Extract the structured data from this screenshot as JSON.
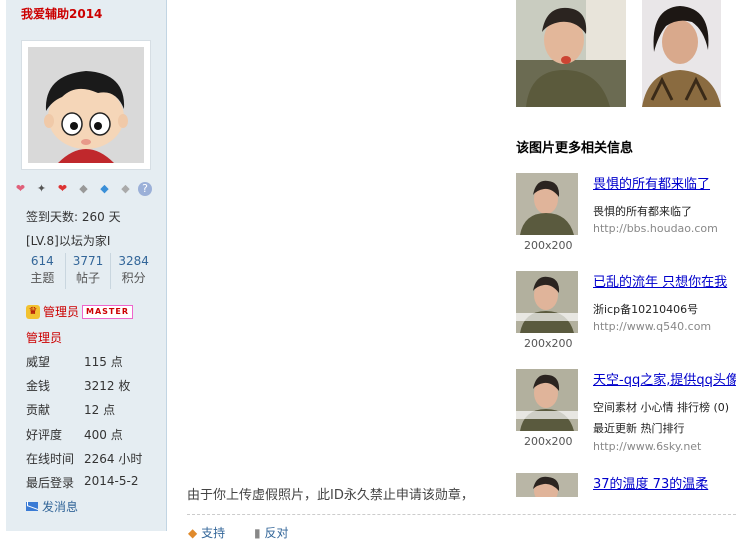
{
  "user": {
    "username": "我爱辅助2014",
    "checkin": "签到天数: 260 天",
    "level": "[LV.8]以坛为家I",
    "stats": [
      {
        "num": "614",
        "label": "主题"
      },
      {
        "num": "3771",
        "label": "帖子"
      },
      {
        "num": "3284",
        "label": "积分"
      }
    ],
    "group_badge_label": "管理员",
    "group_badge_tag": "MASTER",
    "group_name": "管理员",
    "fields": [
      {
        "k": "威望",
        "v": "115 点"
      },
      {
        "k": "金钱",
        "v": "3212 枚"
      },
      {
        "k": "贡献",
        "v": "12 点"
      },
      {
        "k": "好评度",
        "v": "400 点"
      },
      {
        "k": "在线时间",
        "v": "2264 小时"
      },
      {
        "k": "最后登录",
        "v": "2014-5-2"
      }
    ],
    "pm_label": "发消息",
    "medal_icons": [
      "heart-medal-icon",
      "star-medal-icon",
      "heart-red-medal-icon",
      "diamond-medal-icon",
      "gem-medal-icon",
      "diamond-silver-medal-icon",
      "question-medal-icon"
    ]
  },
  "related": {
    "title": "该图片更多相关信息",
    "items": [
      {
        "title": "畏惧的所有都来临了",
        "desc": "畏惧的所有都来临了",
        "url": "http://bbs.houdao.com",
        "size": "200x200"
      },
      {
        "title": "已乱的流年 只想你在我",
        "desc": "浙icp备10210406号",
        "url": "http://www.q540.com",
        "size": "200x200"
      },
      {
        "title": "天空-qq之家,提供qq头像",
        "desc": "空间素材 小心情 排行榜 (0)",
        "desc2": "最近更新 热门排行",
        "url": "http://www.6sky.net",
        "size": "200x200"
      },
      {
        "title": "37的温度 73的温柔"
      }
    ]
  },
  "post": {
    "notice": "由于你上传虚假照片，此ID永久禁止申请该勋章，"
  },
  "footer": {
    "link1": "支持",
    "link2": "反对"
  }
}
